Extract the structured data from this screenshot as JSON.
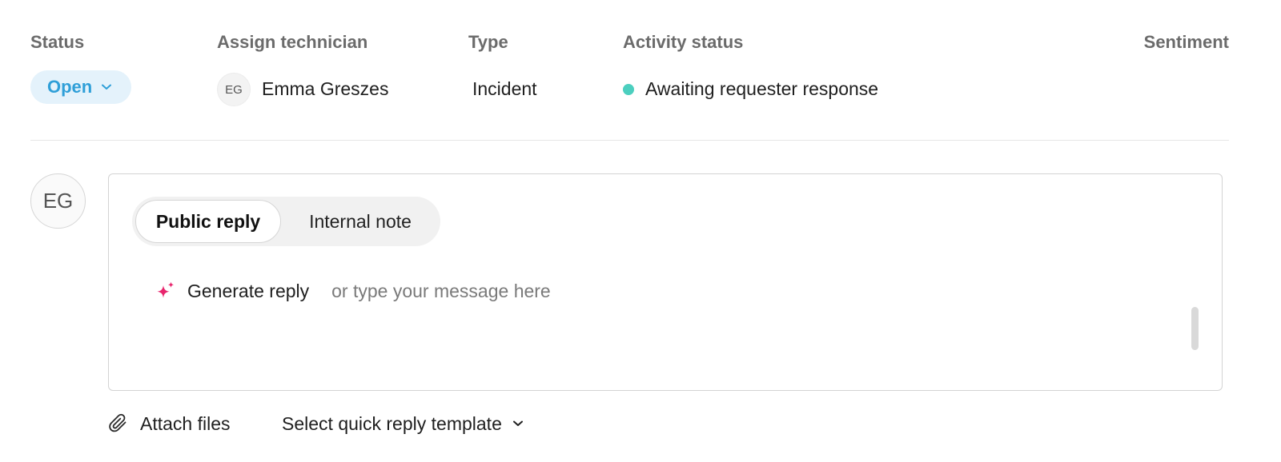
{
  "header": {
    "status": {
      "label": "Status",
      "value": "Open"
    },
    "technician": {
      "label": "Assign technician",
      "initials": "EG",
      "name": "Emma Greszes"
    },
    "type": {
      "label": "Type",
      "value": "Incident"
    },
    "activity": {
      "label": "Activity status",
      "value": "Awaiting requester response"
    },
    "sentiment": {
      "label": "Sentiment"
    }
  },
  "composer": {
    "avatar_initials": "EG",
    "tabs": [
      {
        "label": "Public reply",
        "active": true
      },
      {
        "label": "Internal note",
        "active": false
      }
    ],
    "generate_label": "Generate reply",
    "message_placeholder": "or type your message here",
    "message_value": ""
  },
  "footer": {
    "attach_label": "Attach files",
    "template_label": "Select quick reply template"
  },
  "colors": {
    "status_pill_bg": "#e4f2fb",
    "status_accent": "#2f9fd8",
    "activity_dot": "#4ccfbf",
    "sparkle": "#e8256d"
  },
  "icons": {
    "status_dropdown": "chevron-down-icon",
    "generate": "sparkle-icon",
    "attach": "paperclip-icon",
    "template_dropdown": "chevron-down-icon"
  }
}
